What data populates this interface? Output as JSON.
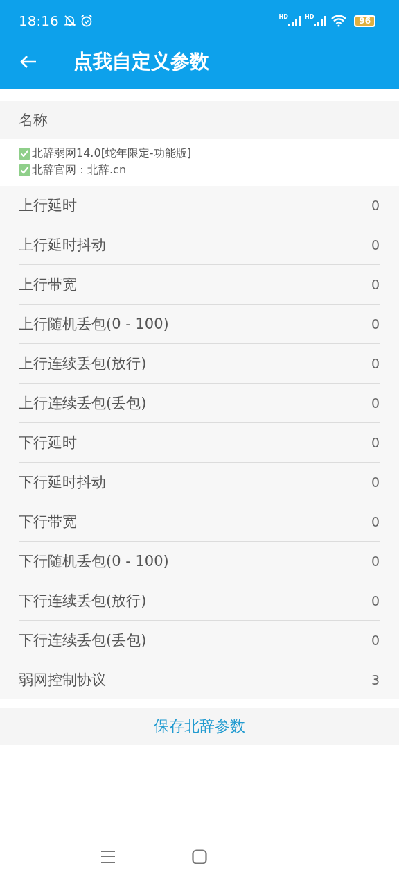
{
  "status_bar": {
    "time": "18:16",
    "battery": "96",
    "network_1": "HD",
    "network_2": "HD"
  },
  "app_bar": {
    "title": "点我自定义参数"
  },
  "section": {
    "header": "名称",
    "notes": [
      {
        "checked": true,
        "text": "北辞弱网14.0[蛇年限定-功能版]"
      },
      {
        "checked": true,
        "text": "北辞官网：北辞.cn"
      }
    ]
  },
  "params": [
    {
      "label": "上行延时",
      "value": "0"
    },
    {
      "label": "上行延时抖动",
      "value": "0"
    },
    {
      "label": "上行带宽",
      "value": "0"
    },
    {
      "label": "上行随机丢包(0 - 100)",
      "value": "0"
    },
    {
      "label": "上行连续丢包(放行)",
      "value": "0"
    },
    {
      "label": "上行连续丢包(丢包)",
      "value": "0"
    },
    {
      "label": "下行延时",
      "value": "0"
    },
    {
      "label": "下行延时抖动",
      "value": "0"
    },
    {
      "label": "下行带宽",
      "value": "0"
    },
    {
      "label": "下行随机丢包(0 - 100)",
      "value": "0"
    },
    {
      "label": "下行连续丢包(放行)",
      "value": "0"
    },
    {
      "label": "下行连续丢包(丢包)",
      "value": "0"
    },
    {
      "label": "弱网控制协议",
      "value": "3"
    }
  ],
  "save_button": "保存北辞参数"
}
